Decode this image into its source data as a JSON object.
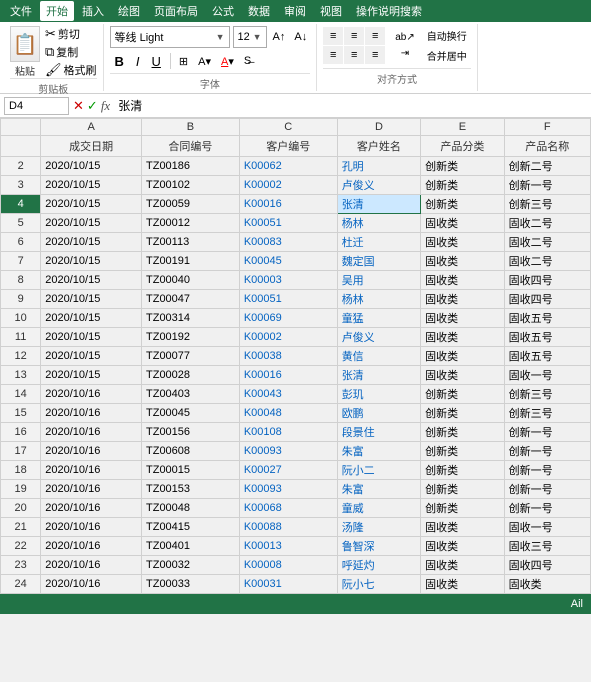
{
  "menubar": {
    "items": [
      "文件",
      "开始",
      "插入",
      "绘图",
      "页面布局",
      "公式",
      "数据",
      "审阅",
      "视图",
      "操作说明搜索"
    ],
    "active": "开始"
  },
  "ribbon": {
    "font_name": "等线 Light",
    "font_size": "12",
    "clipboard_label": "剪贴板",
    "font_label": "字体",
    "alignment_label": "对齐方式",
    "paste_label": "粘贴",
    "cut_label": "剪切",
    "copy_label": "复制",
    "format_painter_label": "格式刷",
    "bold_label": "B",
    "italic_label": "I",
    "underline_label": "U",
    "autowrap_label": "自动换行",
    "merge_label": "合并居中"
  },
  "formula_bar": {
    "cell_ref": "D4",
    "formula_value": "张清"
  },
  "headers": {
    "row_num": "",
    "col_a": "成交日期",
    "col_b": "合同编号",
    "col_c": "客户编号",
    "col_d": "客户姓名",
    "col_e": "产品分类",
    "col_f": "产品名称"
  },
  "rows": [
    {
      "num": "2",
      "a": "2020/10/15",
      "b": "TZ00186",
      "c": "K00062",
      "d": "孔明",
      "e": "创新类",
      "f": "创新二号",
      "d_blue": true
    },
    {
      "num": "3",
      "a": "2020/10/15",
      "b": "TZ00102",
      "c": "K00002",
      "d": "卢俊义",
      "e": "创新类",
      "f": "创新一号",
      "d_blue": true
    },
    {
      "num": "4",
      "a": "2020/10/15",
      "b": "TZ00059",
      "c": "K00016",
      "d": "张清",
      "e": "创新类",
      "f": "创新三号",
      "d_blue": true,
      "selected": true
    },
    {
      "num": "5",
      "a": "2020/10/15",
      "b": "TZ00012",
      "c": "K00051",
      "d": "杨林",
      "e": "固收类",
      "f": "固收二号",
      "d_blue": true
    },
    {
      "num": "6",
      "a": "2020/10/15",
      "b": "TZ00113",
      "c": "K00083",
      "d": "杜迁",
      "e": "固收类",
      "f": "固收二号",
      "d_blue": true
    },
    {
      "num": "7",
      "a": "2020/10/15",
      "b": "TZ00191",
      "c": "K00045",
      "d": "魏定国",
      "e": "固收类",
      "f": "固收二号",
      "d_blue": true
    },
    {
      "num": "8",
      "a": "2020/10/15",
      "b": "TZ00040",
      "c": "K00003",
      "d": "吴用",
      "e": "固收类",
      "f": "固收四号",
      "d_blue": true
    },
    {
      "num": "9",
      "a": "2020/10/15",
      "b": "TZ00047",
      "c": "K00051",
      "d": "杨林",
      "e": "固收类",
      "f": "固收四号",
      "d_blue": true
    },
    {
      "num": "10",
      "a": "2020/10/15",
      "b": "TZ00314",
      "c": "K00069",
      "d": "童猛",
      "e": "固收类",
      "f": "固收五号",
      "d_blue": true
    },
    {
      "num": "11",
      "a": "2020/10/15",
      "b": "TZ00192",
      "c": "K00002",
      "d": "卢俊义",
      "e": "固收类",
      "f": "固收五号",
      "d_blue": true
    },
    {
      "num": "12",
      "a": "2020/10/15",
      "b": "TZ00077",
      "c": "K00038",
      "d": "黄信",
      "e": "固收类",
      "f": "固收五号",
      "d_blue": true
    },
    {
      "num": "13",
      "a": "2020/10/15",
      "b": "TZ00028",
      "c": "K00016",
      "d": "张清",
      "e": "固收类",
      "f": "固收一号",
      "d_blue": true
    },
    {
      "num": "14",
      "a": "2020/10/16",
      "b": "TZ00403",
      "c": "K00043",
      "d": "彭玑",
      "e": "创新类",
      "f": "创新三号",
      "d_blue": true
    },
    {
      "num": "15",
      "a": "2020/10/16",
      "b": "TZ00045",
      "c": "K00048",
      "d": "欧鹏",
      "e": "创新类",
      "f": "创新三号",
      "d_blue": true
    },
    {
      "num": "16",
      "a": "2020/10/16",
      "b": "TZ00156",
      "c": "K00108",
      "d": "段景住",
      "e": "创新类",
      "f": "创新一号",
      "d_blue": true
    },
    {
      "num": "17",
      "a": "2020/10/16",
      "b": "TZ00608",
      "c": "K00093",
      "d": "朱富",
      "e": "创新类",
      "f": "创新一号",
      "d_blue": true
    },
    {
      "num": "18",
      "a": "2020/10/16",
      "b": "TZ00015",
      "c": "K00027",
      "d": "阮小二",
      "e": "创新类",
      "f": "创新一号",
      "d_blue": true
    },
    {
      "num": "19",
      "a": "2020/10/16",
      "b": "TZ00153",
      "c": "K00093",
      "d": "朱富",
      "e": "创新类",
      "f": "创新一号",
      "d_blue": true
    },
    {
      "num": "20",
      "a": "2020/10/16",
      "b": "TZ00048",
      "c": "K00068",
      "d": "童威",
      "e": "创新类",
      "f": "创新一号",
      "d_blue": true
    },
    {
      "num": "21",
      "a": "2020/10/16",
      "b": "TZ00415",
      "c": "K00088",
      "d": "汤隆",
      "e": "固收类",
      "f": "固收一号",
      "d_blue": true
    },
    {
      "num": "22",
      "a": "2020/10/16",
      "b": "TZ00401",
      "c": "K00013",
      "d": "鲁智深",
      "e": "固收类",
      "f": "固收三号",
      "d_blue": true
    },
    {
      "num": "23",
      "a": "2020/10/16",
      "b": "TZ00032",
      "c": "K00008",
      "d": "呼延灼",
      "e": "固收类",
      "f": "固收四号",
      "d_blue": true
    },
    {
      "num": "24",
      "a": "2020/10/16",
      "b": "TZ00033",
      "c": "K00031",
      "d": "阮小七",
      "e": "固收类",
      "f": "固收类",
      "d_blue": true
    }
  ],
  "status_bar": {
    "text": "Ail"
  }
}
